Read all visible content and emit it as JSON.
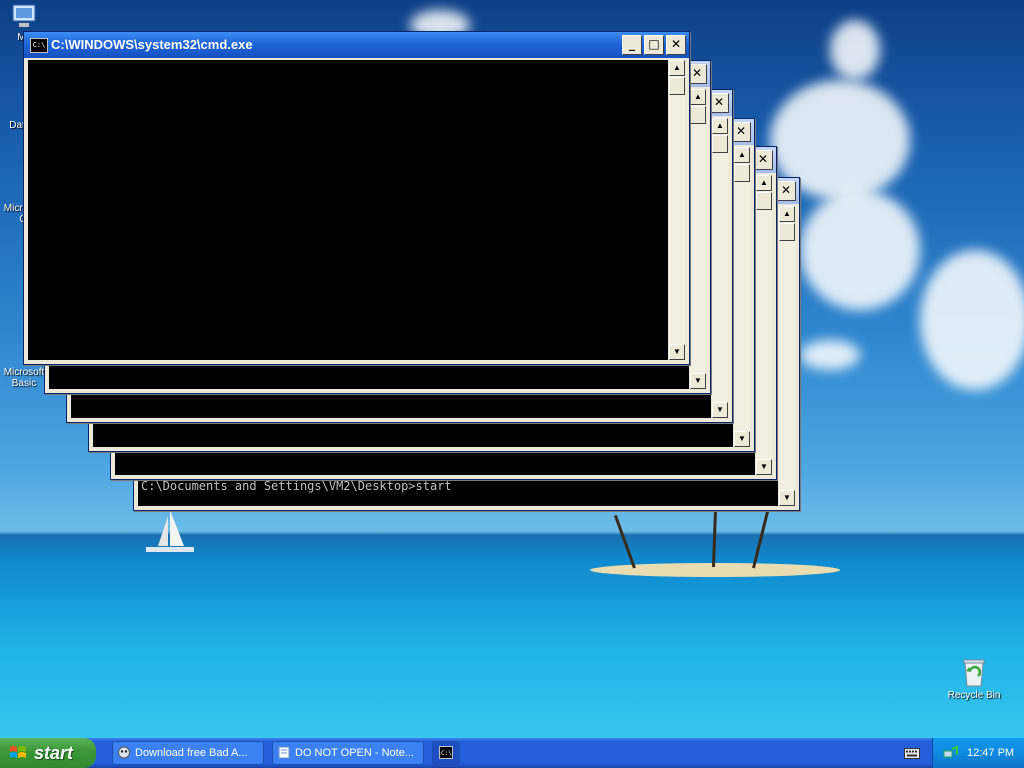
{
  "desktop": {
    "icons": [
      {
        "label": "My"
      },
      {
        "label": "Dat"
      },
      {
        "label": "Micro"
      },
      {
        "label": "C"
      },
      {
        "label": "Microsoft"
      },
      {
        "label": "Basic"
      },
      {
        "label": "Recycle Bin"
      }
    ]
  },
  "cmd_windows": [
    {
      "title": "C:\\WINDOWS\\system32\\cmd.exe",
      "active": true,
      "console_text": ""
    },
    {
      "title": "",
      "active": false,
      "console_text": ""
    },
    {
      "title": "",
      "active": false,
      "console_text": ""
    },
    {
      "title": "",
      "active": false,
      "console_text": ""
    },
    {
      "title": "",
      "active": false,
      "console_text": ""
    },
    {
      "title": "",
      "active": false,
      "console_text": "C:\\Documents and Settings\\VM2\\Desktop>start"
    }
  ],
  "window_controls": {
    "minimize": "_",
    "maximize": "□",
    "close": "✕"
  },
  "taskbar": {
    "start_label": "start",
    "tasks": [
      {
        "label": "Download free Bad A...",
        "icon": "browser-icon"
      },
      {
        "label": "DO NOT OPEN - Note...",
        "icon": "notepad-icon"
      },
      {
        "label": "",
        "icon": "cmd-icon"
      }
    ],
    "clock": "12:47 PM"
  },
  "colors": {
    "taskbar_blue": "#245edb",
    "start_green": "#3c9a3a",
    "active_title": "#1f64d8",
    "inactive_title": "#a4bef0"
  }
}
